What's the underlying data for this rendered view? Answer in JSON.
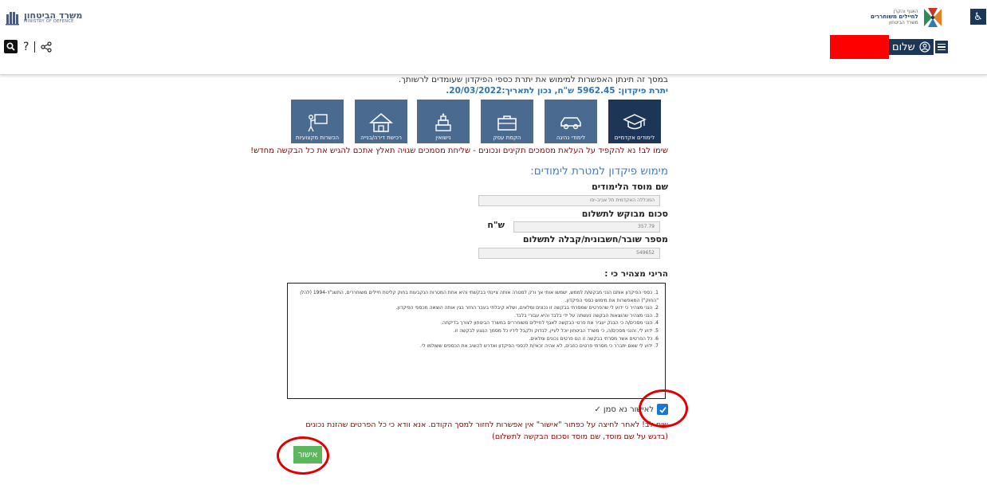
{
  "header": {
    "mod_logo_he": "משרד הביטחון",
    "mod_logo_en": "MINISTRY OF DEFENCE",
    "help_label": "?",
    "accessibility_glyph": "♿",
    "ifc_logo_line1": "האגף והקרן",
    "ifc_logo_line2": "לחיילים משוחררים",
    "ifc_logo_line3": "משרד הביטחון",
    "greeting": "שלום",
    "redaction_color": "#ff0000"
  },
  "main": {
    "intro_text": "במסך זה תינתן האפשרות למימוש את יתרת כספי הפיקדון שעומדים לרשותך.",
    "balance_text": "יתרת פיקדון: 5962.45 ש\"ח, נכון לתאריך:20/03/2022.",
    "tiles": [
      {
        "label": "לימודים אקדמיים",
        "icon": "graduation-cap-icon",
        "active": true
      },
      {
        "label": "לימודי נהיגה",
        "icon": "car-icon",
        "active": false
      },
      {
        "label": "הקמת עסק",
        "icon": "briefcase-icon",
        "active": false
      },
      {
        "label": "נישואין",
        "icon": "wedding-cake-icon",
        "active": false
      },
      {
        "label": "רכישת דירה/בנייה",
        "icon": "house-icon",
        "active": false
      },
      {
        "label": "הכשרות מקצועיות",
        "icon": "presenter-icon",
        "active": false
      }
    ],
    "notice": "שימו לב! נא להקפיד על העלאת מסמכים תקינים ונכונים - שליחת מסמכים שגויה תאלץ אתכם להגיש את כל הבקשה מחדש!",
    "section_title": "מימוש פיקדון למטרת לימודים:",
    "fields": {
      "institution_label": "שם מוסד הלימודים",
      "institution_value": "המכללה האקדמית תל אביב-יפו",
      "amount_label": "סכום מבוקש לתשלום",
      "amount_value": "357.79",
      "currency": "ש\"ח",
      "invoice_label": "מספר שובר/חשבונית/קבלה לתשלום",
      "invoice_value": "549652"
    },
    "declaration_title": "הריני מצהיר כי :",
    "terms": [
      "1. כספי הפיקדון אותם הנני מבקש/ת לממש, ישמשו אותי אך ורק למטרה אותה ציינתי בבקשתי והיא אחת המטרות הנקבעות בחוק קליטת חיילים משוחררים, התשנ\"ד-1994 (להלן \"החוק\") המאפשרות את מימוש כספי הפיקדון.",
      "2. הנני מצהיר כי ידוע לי שהפרטים שמסרתי בבקשה זו נכונים ומלאים, ושלא קיבלתי בעבר החזר בגין אותה הוצאה מכספי הפיקדון.",
      "3. הנני מצהיר שהוצאות הבקשה נעשתה על ידי בלבד והיא עבורי בלבד.",
      "4. הנני מסכים/ה כי הבנק יעביר את פרטי הבקשה לאגף לחיילים משוחררים במשרד הביטחון לצורך בדיקתה.",
      "5. ידוע לי, והנני מסכים/ה, כי משרד הביטחון יוכל לעיין, לבדוק ולקבל לידיו כל מסמך הנוגע לבקשה זו.",
      "6. כל הפרטים אשר מסרתי בבקשה זו הם פרטים נכונים ומלאים.",
      "7. ידוע לי שאם יתברר כי מסרתי פרטים כוזבים, לא אהיה זכאי/ת לכספי הפיקדון ואדרש להשיב את הכספים ששולמו לי."
    ],
    "agree_label": "לאישור נא סמן ✓",
    "warning_text": "שים לב! לאחר לחיצה על כפתור \"אישור\" אין אפשרות לחזור למסך הקודם. אנא וודא כי כל הפרטים שהזנת נכונים (בדגש על שם מוסד, שם מוסד וסכום הבקשה לתשלום)",
    "approve_label": "אישור"
  },
  "colors": {
    "header_navy": "#1d3557",
    "tile_blue": "#4a6b8f",
    "link_blue": "#2e75b6",
    "notice_red": "#8b0000",
    "approve_green": "#5cb85c",
    "annotation_red": "#e00000"
  }
}
